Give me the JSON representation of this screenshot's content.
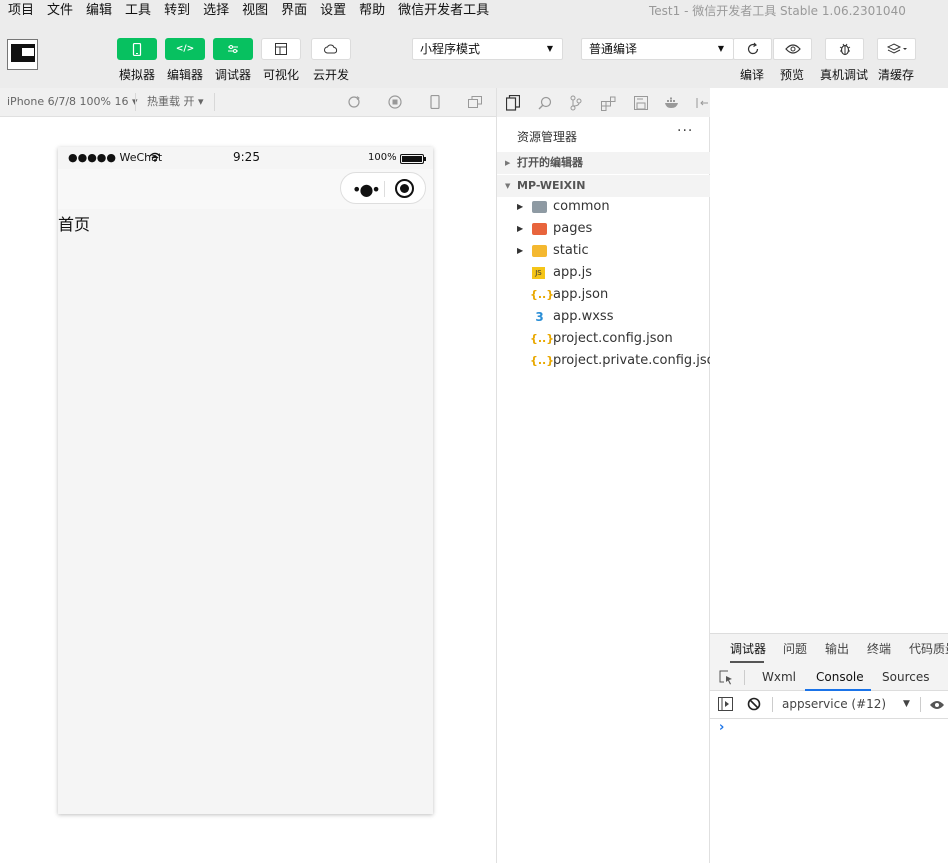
{
  "menu": {
    "items": [
      "项目",
      "文件",
      "编辑",
      "工具",
      "转到",
      "选择",
      "视图",
      "界面",
      "设置",
      "帮助",
      "微信开发者工具"
    ],
    "window_title": "Test1 - 微信开发者工具 Stable 1.06.2301040"
  },
  "toolbar": {
    "simulator_label": "模拟器",
    "editor_label": "编辑器",
    "debugger_label": "调试器",
    "visual_label": "可视化",
    "cloud_label": "云开发",
    "mode_select": "小程序模式",
    "compile_select": "普通编译",
    "compile_label": "编译",
    "preview_label": "预览",
    "remote_debug_label": "真机调试",
    "clear_cache_label": "清缓存"
  },
  "simbar": {
    "device": "iPhone 6/7/8 100% 16 ▾",
    "hot_reload": "热重载 开 ▾"
  },
  "phone": {
    "signal": "●●●●● WeChat",
    "time": "9:25",
    "battery_pct": "100%",
    "page_text": "首页"
  },
  "explorer": {
    "title": "资源管理器",
    "more": "···",
    "open_editors": "打开的编辑器",
    "project": "MP-WEIXIN",
    "folders": [
      "common",
      "pages",
      "static"
    ],
    "files": [
      "app.js",
      "app.json",
      "app.wxss",
      "project.config.json",
      "project.private.config.json"
    ]
  },
  "devtools": {
    "top_tabs": [
      "调试器",
      "问题",
      "输出",
      "终端",
      "代码质量"
    ],
    "sub_tabs": [
      "Wxml",
      "Console",
      "Sources"
    ],
    "context": "appservice (#12)",
    "prompt": "›"
  },
  "colors": {
    "accent_green": "#07c160",
    "console_blue": "#1a73e8"
  }
}
